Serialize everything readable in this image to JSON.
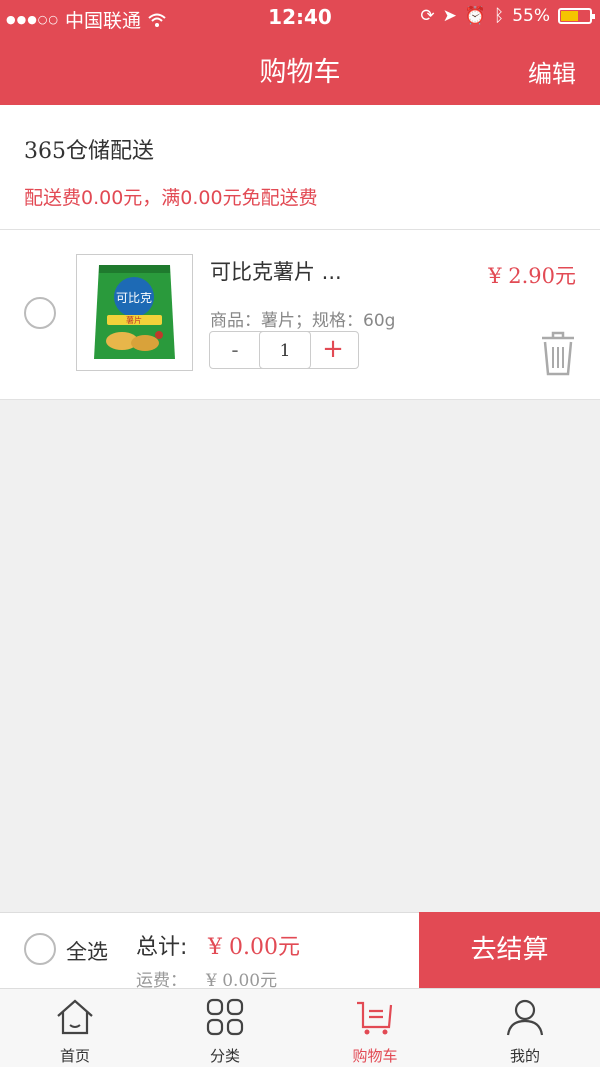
{
  "status_bar": {
    "carrier": "中国联通",
    "time": "12:40",
    "battery": "55%"
  },
  "nav": {
    "title": "购物车",
    "edit_label": "编辑"
  },
  "warehouse": {
    "name": "365仓储配送",
    "fee_text": "配送费0.00元，满0.00元免配送费"
  },
  "items": [
    {
      "name": "可比克薯片 ...",
      "price": "¥ 2.90元",
      "spec": "商品：薯片；规格：60g",
      "quantity": "1",
      "minus_label": "-",
      "plus_label": "+",
      "thumb_brand": "可比克",
      "thumb_flavor": "薯片"
    }
  ],
  "footer": {
    "select_all_label": "全选",
    "total_label": "总计:",
    "total_value": "¥ 0.00元",
    "shipping_label": "运费：",
    "shipping_value": "¥ 0.00元",
    "checkout_label": "去结算"
  },
  "tabs": [
    {
      "label": "首页",
      "icon": "home-icon"
    },
    {
      "label": "分类",
      "icon": "category-icon"
    },
    {
      "label": "购物车",
      "icon": "cart-icon",
      "active": true
    },
    {
      "label": "我的",
      "icon": "user-icon"
    }
  ],
  "colors": {
    "accent": "#e24a54",
    "background": "#f0f0f0",
    "battery": "#f5c400"
  }
}
